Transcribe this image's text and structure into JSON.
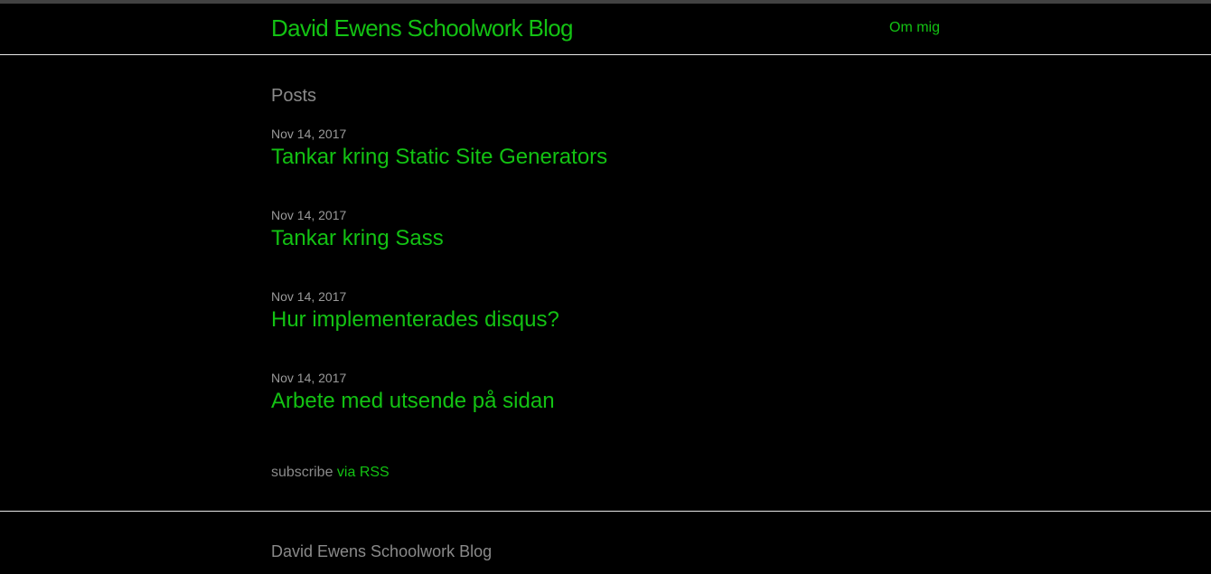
{
  "header": {
    "site_title": "David Ewens Schoolwork Blog",
    "nav": [
      {
        "label": "Om mig"
      }
    ]
  },
  "main": {
    "posts_heading": "Posts",
    "posts": [
      {
        "date": "Nov 14, 2017",
        "title": "Tankar kring Static Site Generators"
      },
      {
        "date": "Nov 14, 2017",
        "title": "Tankar kring Sass"
      },
      {
        "date": "Nov 14, 2017",
        "title": "Hur implementerades disqus?"
      },
      {
        "date": "Nov 14, 2017",
        "title": "Arbete med utsende på sidan"
      }
    ],
    "subscribe": {
      "prefix": "subscribe ",
      "link_label": "via RSS"
    }
  },
  "footer": {
    "title": "David Ewens Schoolwork Blog"
  },
  "colors": {
    "background": "#000000",
    "accent_green": "#13c213",
    "muted_text": "#8a8a8a",
    "rule": "#e8e8e8"
  }
}
